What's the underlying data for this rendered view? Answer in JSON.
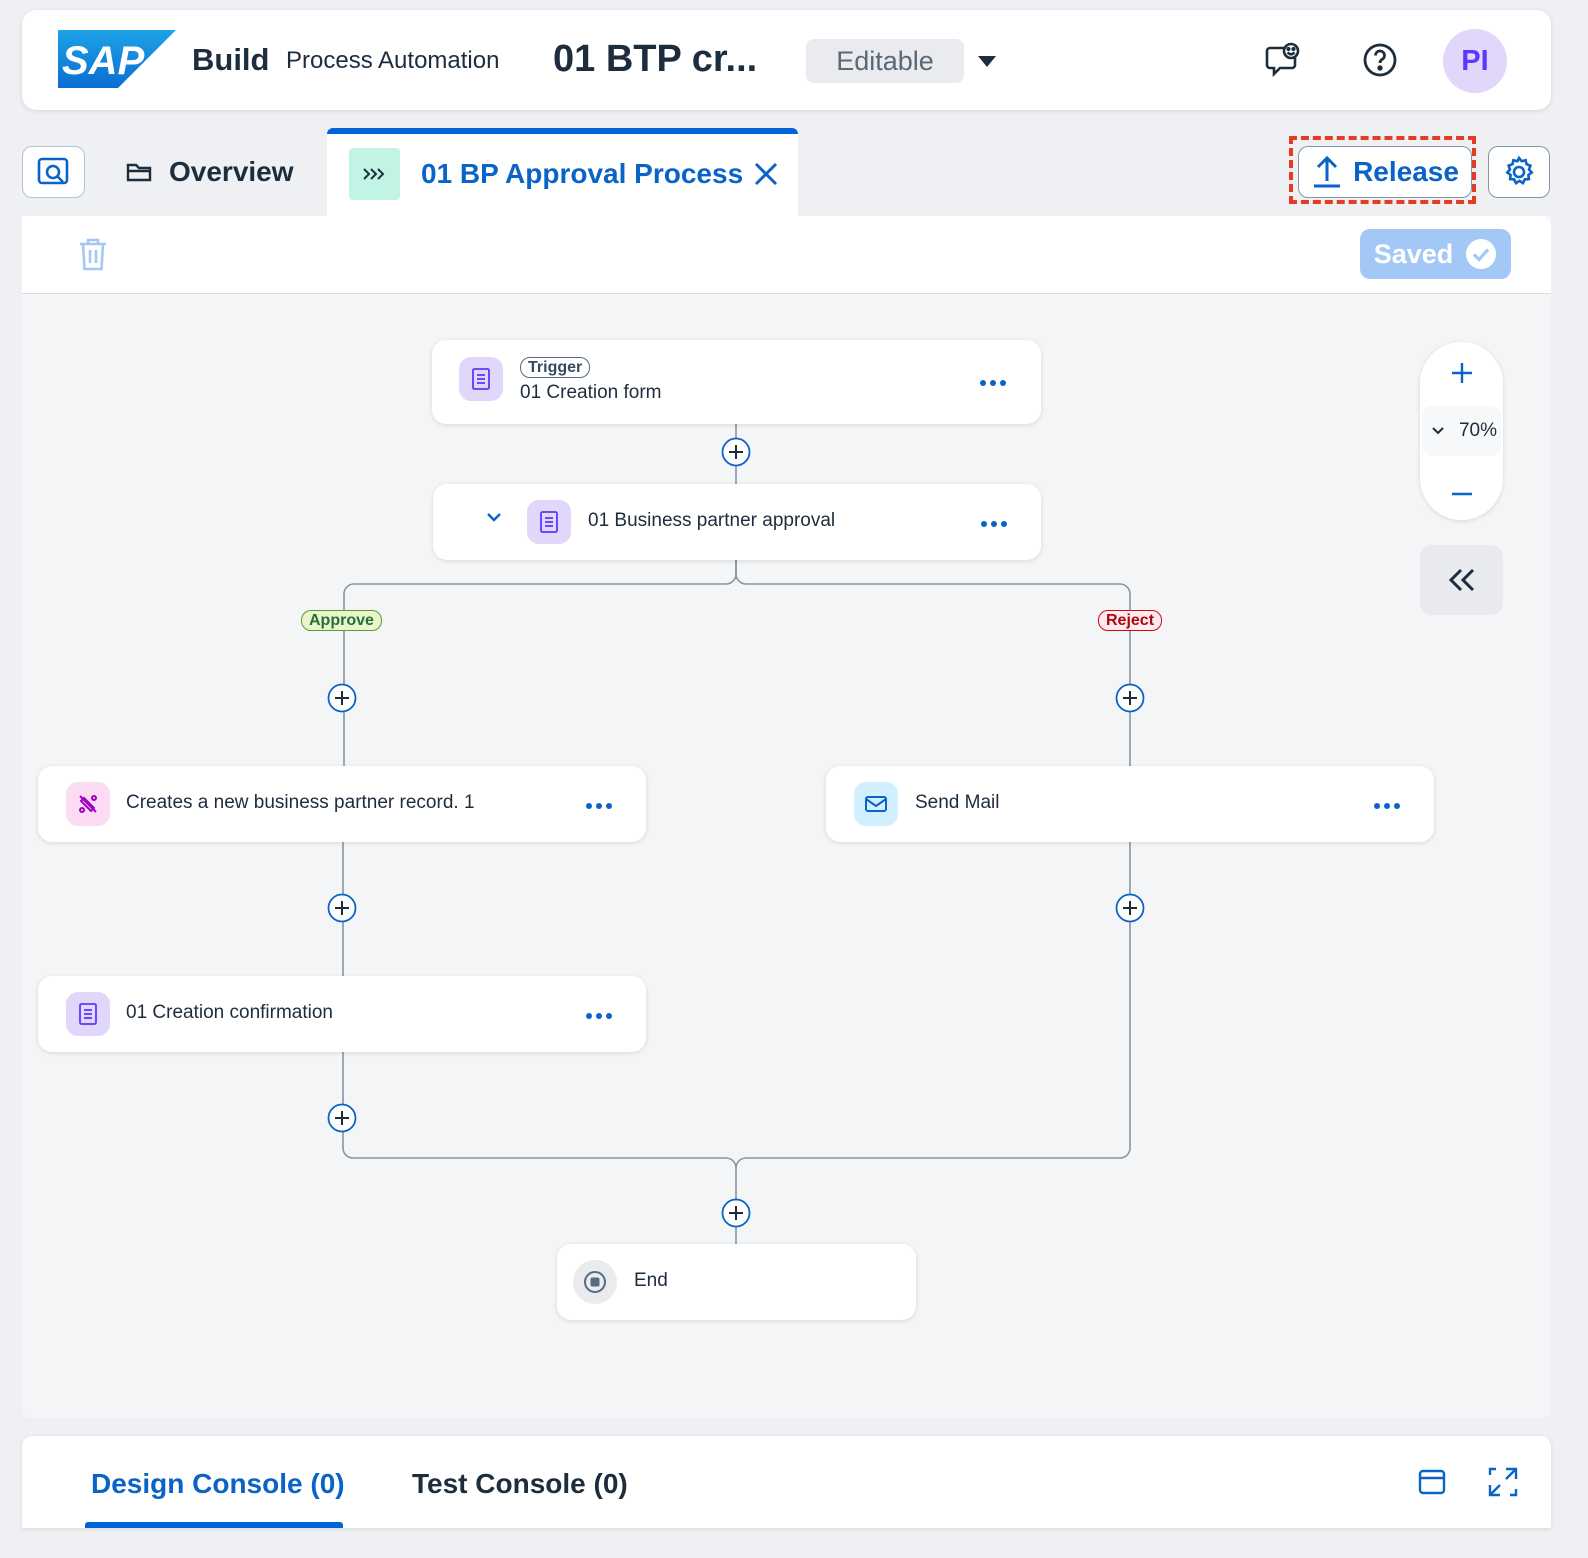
{
  "shellbar": {
    "logo_text": "SAP",
    "product": "Build",
    "product_sub": "Process Automation",
    "project_title": "01 BTP cr...",
    "mode": "Editable",
    "avatar_initials": "PI",
    "icons": [
      "feedback-icon",
      "help-icon",
      "caret-down-icon"
    ]
  },
  "tabs": {
    "overview_label": "Overview",
    "process_label": "01 BP Approval Process",
    "release_label": "Release"
  },
  "toolbar": {
    "saved_label": "Saved"
  },
  "flow": {
    "trigger": {
      "tag": "Trigger",
      "label": "01 Creation form"
    },
    "approval": {
      "label": "01 Business partner approval"
    },
    "branches": {
      "approve": "Approve",
      "reject": "Reject"
    },
    "create_bp": {
      "label": "Creates a new business partner record. 1"
    },
    "send_mail": {
      "label": "Send Mail"
    },
    "confirmation": {
      "label": "01 Creation confirmation"
    },
    "end": {
      "label": "End"
    }
  },
  "zoom": {
    "level": "70%"
  },
  "console": {
    "design_tab": "Design Console (0)",
    "test_tab": "Test Console (0)"
  },
  "colors": {
    "brand_blue": "#0064d9",
    "link_blue": "#0a63c7",
    "highlight_red": "#e53a23",
    "form_icon_bg": "#e0d7fb",
    "approve_green": "#256f3a",
    "reject_red": "#aa0808"
  }
}
